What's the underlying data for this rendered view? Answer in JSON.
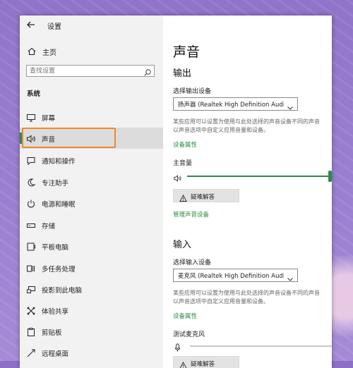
{
  "window": {
    "title": "设置"
  },
  "sidebar": {
    "home_label": "主页",
    "search_placeholder": "查找设置",
    "section_title": "系统",
    "items": [
      {
        "label": "屏幕",
        "icon": "monitor-icon"
      },
      {
        "label": "声音",
        "icon": "speaker-icon",
        "active": true
      },
      {
        "label": "通知和操作",
        "icon": "notification-icon"
      },
      {
        "label": "专注助手",
        "icon": "moon-icon"
      },
      {
        "label": "电源和睡眠",
        "icon": "power-icon"
      },
      {
        "label": "存储",
        "icon": "storage-icon"
      },
      {
        "label": "平板电脑",
        "icon": "tablet-icon"
      },
      {
        "label": "多任务处理",
        "icon": "multitask-icon"
      },
      {
        "label": "投影到此电脑",
        "icon": "projection-icon"
      },
      {
        "label": "体验共享",
        "icon": "shared-experience-icon"
      },
      {
        "label": "剪贴板",
        "icon": "clipboard-icon"
      },
      {
        "label": "远程桌面",
        "icon": "remote-desktop-icon"
      }
    ]
  },
  "main": {
    "title": "声音",
    "output": {
      "heading": "输出",
      "device_label": "选择输出设备",
      "device_value": "扬声器 (Realtek High Definition Audi...",
      "desc_line1": "某些应用可以设置为使用与此处选择的声音设备不同的声音",
      "desc_line2": "以声音选项中自定义应用音量和设备。",
      "device_properties": "设备属性",
      "volume_label": "主音量",
      "volume_level": 1.0,
      "troubleshoot": "疑难解答",
      "manage_devices": "管理声音设备"
    },
    "input": {
      "heading": "输入",
      "device_label": "选择输入设备",
      "device_value": "麦克风 (Realtek High Definition Audi...",
      "desc_line1": "某些应用可以设置为使用与此处选择的声音设备不同的声音",
      "desc_line2": "以声音选项中自定义应用音量和设备。",
      "device_properties": "设备属性",
      "test_label": "测试麦克风",
      "troubleshoot": "疑难解答"
    }
  },
  "colors": {
    "accent": "#2d8a4a",
    "highlight": "#f0892a"
  }
}
